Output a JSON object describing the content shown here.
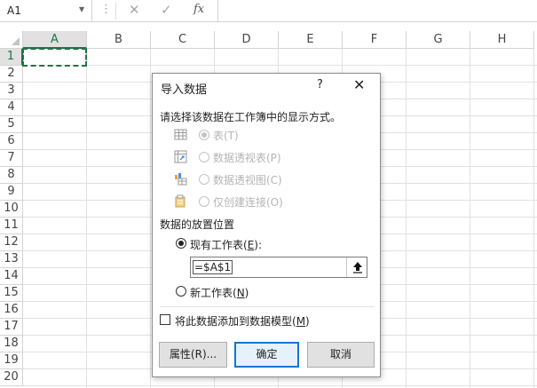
{
  "formula_bar": {
    "name_box": "A1",
    "fx_label": "fx"
  },
  "grid": {
    "columns": [
      "A",
      "B",
      "C",
      "D",
      "E",
      "F",
      "G",
      "H"
    ],
    "rows": [
      "1",
      "2",
      "3",
      "4",
      "5",
      "6",
      "7",
      "8",
      "9",
      "10",
      "11",
      "12",
      "13",
      "14",
      "15",
      "16",
      "17",
      "18",
      "19",
      "20"
    ],
    "selected_cell": "A1"
  },
  "dialog": {
    "title": "导入数据",
    "help": "?",
    "close": "✕",
    "prompt": "请选择该数据在工作簿中的显示方式。",
    "view_options": [
      {
        "label": "表(T)",
        "checked": true,
        "enabled": false,
        "icon": "table-icon"
      },
      {
        "label": "数据透视表(P)",
        "checked": false,
        "enabled": false,
        "icon": "pivot-table-icon"
      },
      {
        "label": "数据透视图(C)",
        "checked": false,
        "enabled": false,
        "icon": "pivot-chart-icon"
      },
      {
        "label": "仅创建连接(O)",
        "checked": false,
        "enabled": false,
        "icon": "connection-icon"
      }
    ],
    "placement_heading": "数据的放置位置",
    "existing_sheet": {
      "label_main": "现有工作表(",
      "label_key": "E",
      "label_tail": "):",
      "checked": true
    },
    "reference_value": "=$A$1",
    "new_sheet": {
      "label_main": "新工作表(",
      "label_key": "N",
      "label_tail": ")",
      "checked": false
    },
    "add_to_model": {
      "label_main": "将此数据添加到数据模型(",
      "label_key": "M",
      "label_tail": ")",
      "checked": false
    },
    "buttons": {
      "properties": "属性(R)...",
      "ok": "确定",
      "cancel": "取消"
    }
  }
}
